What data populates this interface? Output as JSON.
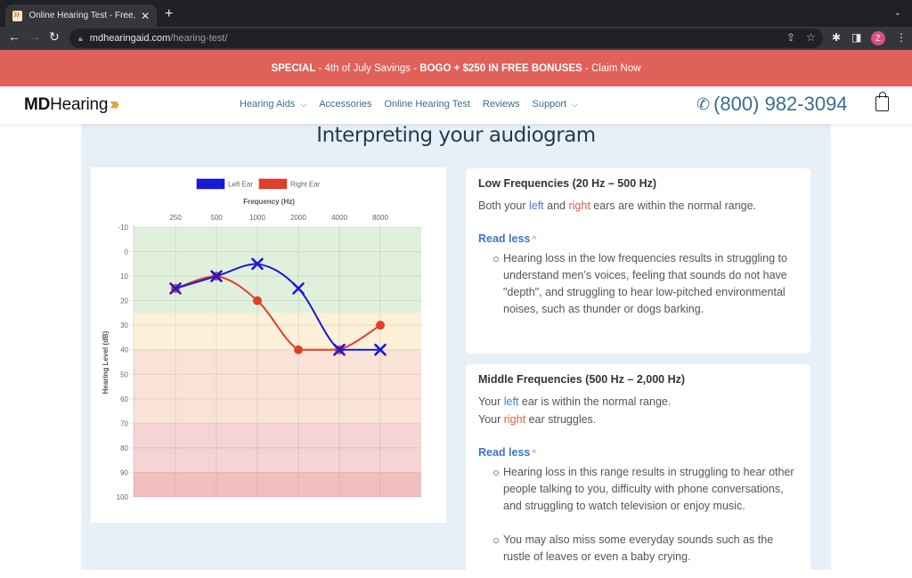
{
  "browser": {
    "tab_title": "Online Hearing Test - Free, Instant Results",
    "url_domain": "mdhearingaid.com",
    "url_path": "/hearing-test/",
    "profile_initial": "Z"
  },
  "promo": {
    "special": "SPECIAL",
    "sep1": " - 4th of July Savings - ",
    "offer": "BOGO + $250 IN FREE BONUSES",
    "cta": " - Claim Now"
  },
  "header": {
    "logo_bold": "MD",
    "logo_rest": "Hearing",
    "nav": [
      {
        "label": "Hearing Aids",
        "has_dropdown": true
      },
      {
        "label": "Accessories",
        "has_dropdown": false
      },
      {
        "label": "Online Hearing Test",
        "has_dropdown": false
      },
      {
        "label": "Reviews",
        "has_dropdown": false
      },
      {
        "label": "Support",
        "has_dropdown": true
      }
    ],
    "phone": "(800) 982-3094"
  },
  "main": {
    "title": "Interpreting your audiogram",
    "cards": [
      {
        "title": "Low Frequencies (20 Hz – 500 Hz)",
        "lines": [
          {
            "pre": "Both your ",
            "left": "left",
            "mid": " and ",
            "right": "right",
            "post": " ears are within the normal range."
          }
        ],
        "toggle": "Read less",
        "bullets": [
          "Hearing loss in the low frequencies results in struggling to understand men’s voices, feeling that sounds do not have \"depth\", and struggling to hear low-pitched environmental noises, such as thunder or dogs barking."
        ]
      },
      {
        "title": "Middle Frequencies (500 Hz – 2,000 Hz)",
        "lines": [
          {
            "pre": "Your ",
            "left": "left",
            "post": " ear is within the normal range."
          },
          {
            "pre": "Your ",
            "right": "right",
            "post": " ear struggles."
          }
        ],
        "toggle": "Read less",
        "bullets": [
          "Hearing loss in this range results in struggling to hear other people talking to you, difficulty with phone conversations, and struggling to watch television or enjoy music.",
          "You may also miss some everyday sounds such as the rustle of leaves or even a baby crying."
        ]
      }
    ]
  },
  "colors": {
    "left_ear": "#1a1ad6",
    "right_ear": "#e0402a",
    "promo_bg": "#e0605a",
    "nav_text": "#3a6f8f"
  },
  "chart_data": {
    "type": "line",
    "title": "",
    "xlabel": "Frequency (Hz)",
    "ylabel": "Hearing Level (dB)",
    "categories": [
      "250",
      "500",
      "1000",
      "2000",
      "4000",
      "8000"
    ],
    "ylim": [
      -10,
      100
    ],
    "y_inverted": true,
    "yticks": [
      -10,
      0,
      10,
      20,
      30,
      40,
      50,
      60,
      70,
      80,
      90,
      100
    ],
    "x_axis_position": "top",
    "legend_position": "top",
    "grid": true,
    "series": [
      {
        "name": "Left Ear",
        "color": "#1a1ad6",
        "marker": "x",
        "values": [
          15,
          10,
          5,
          15,
          40,
          40
        ]
      },
      {
        "name": "Right Ear",
        "color": "#e0402a",
        "marker": "circle",
        "values": [
          15,
          10,
          20,
          40,
          40,
          30
        ]
      }
    ],
    "bands": [
      {
        "from": -10,
        "to": 25,
        "color": "#e1f0dc"
      },
      {
        "from": 25,
        "to": 40,
        "color": "#fcf0d9"
      },
      {
        "from": 40,
        "to": 70,
        "color": "#f8e3d6"
      },
      {
        "from": 70,
        "to": 90,
        "color": "#f6d3d5"
      },
      {
        "from": 90,
        "to": 100,
        "color": "#f1bfbd"
      }
    ]
  }
}
